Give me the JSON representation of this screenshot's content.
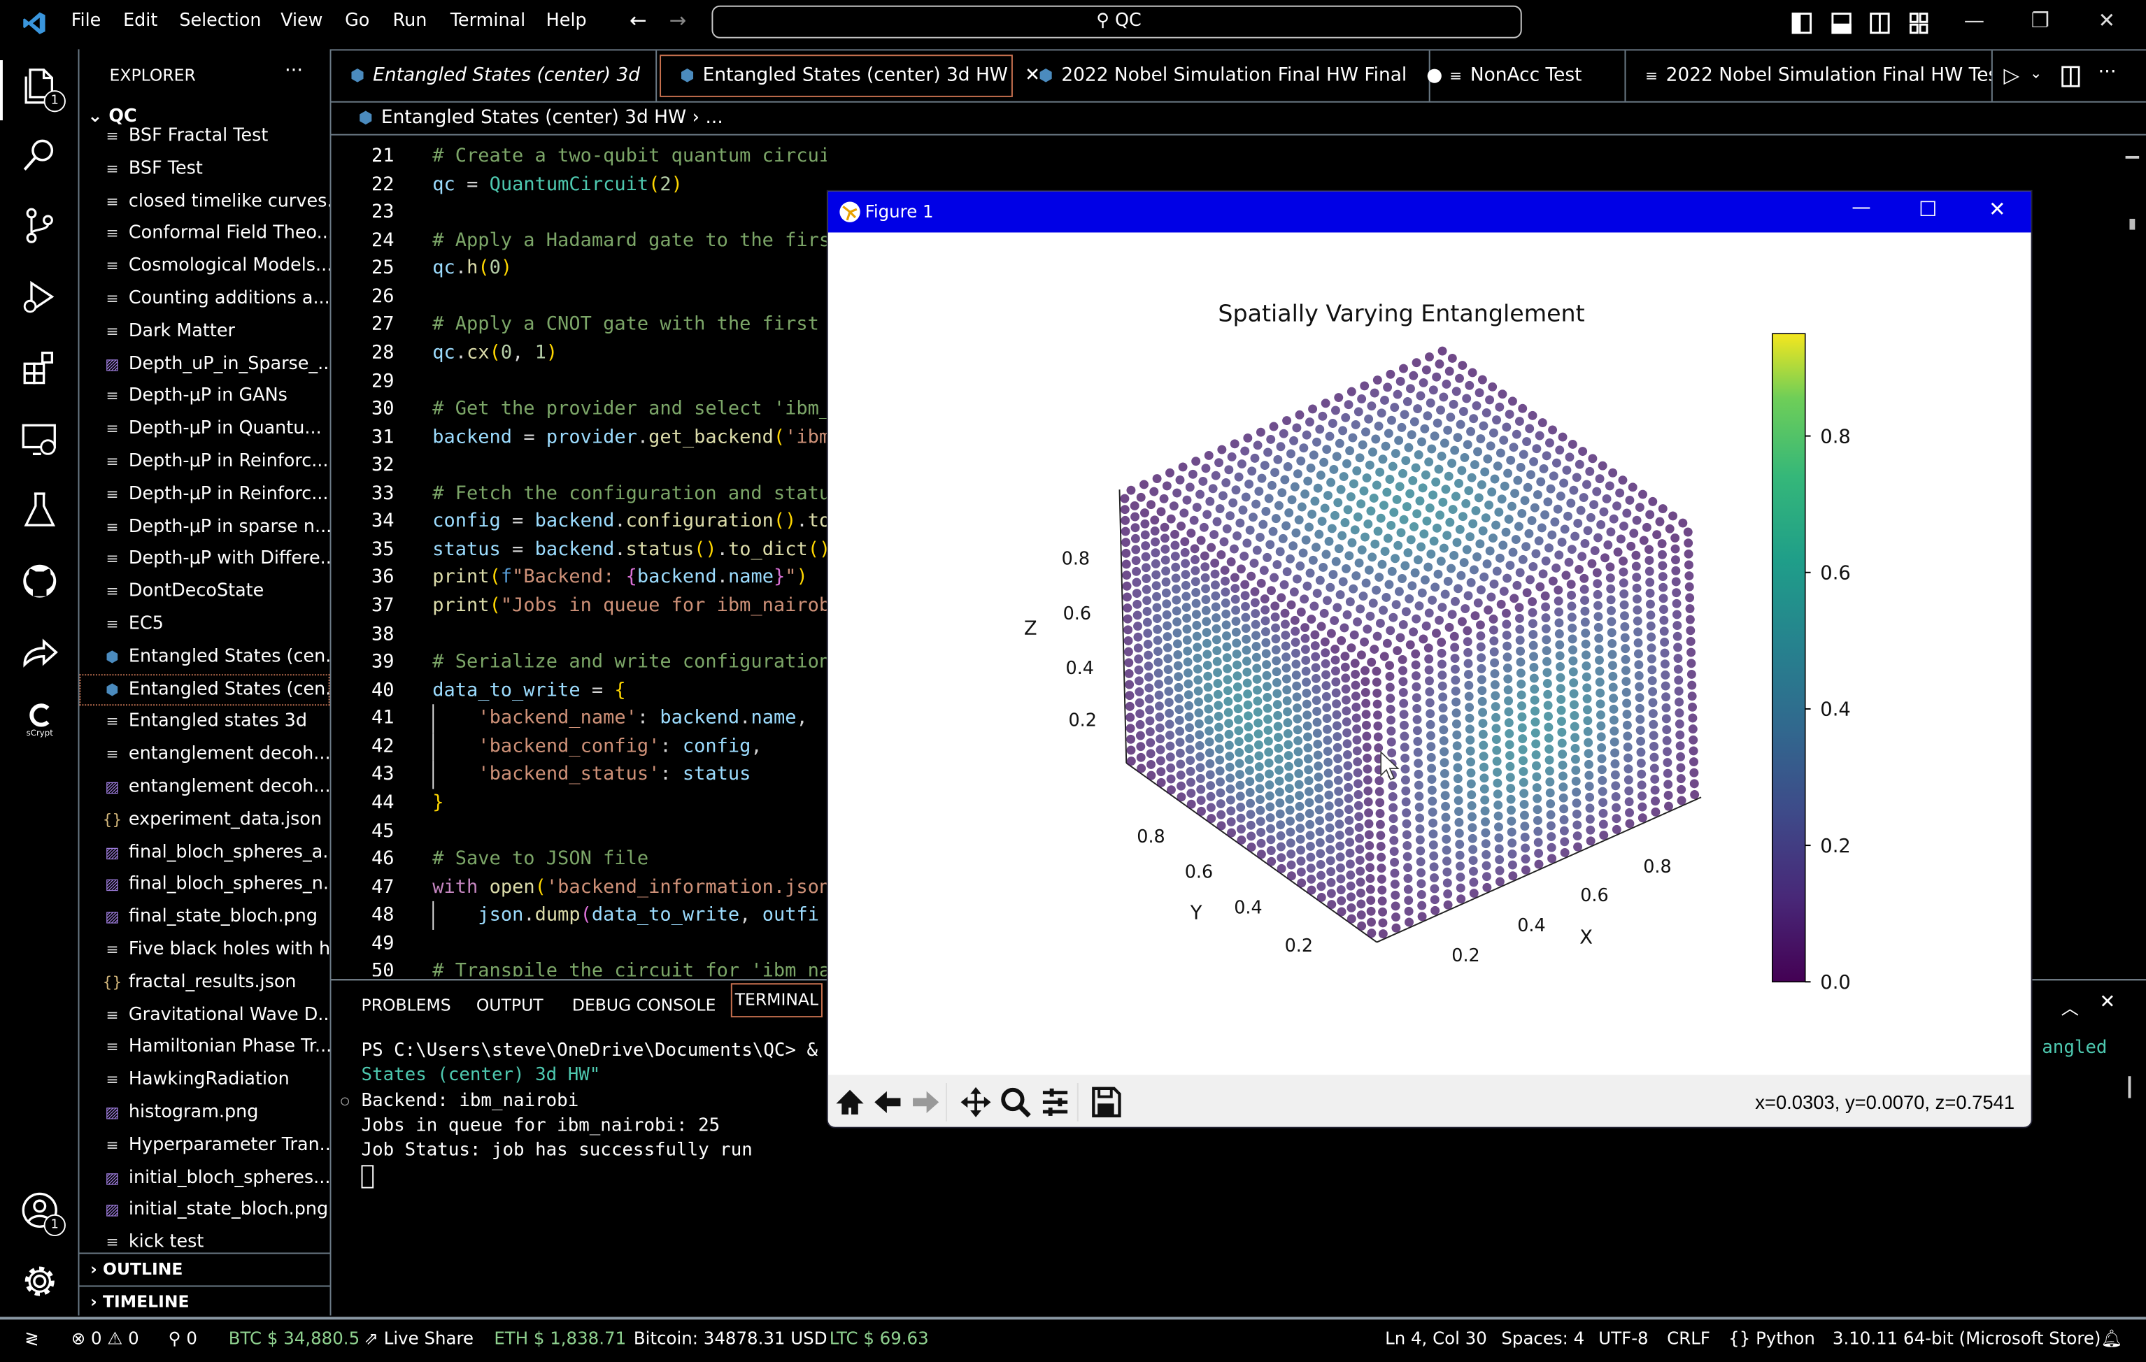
{
  "titlebar": {
    "menu": [
      "File",
      "Edit",
      "Selection",
      "View",
      "Go",
      "Run",
      "Terminal",
      "Help"
    ],
    "search": "QC"
  },
  "activity_bar": {
    "explorer_badge": "1",
    "accounts_badge": "1",
    "scrypt_label": "sCrypt"
  },
  "sidebar": {
    "title": "EXPLORER",
    "more": "···",
    "root": "QC",
    "items": [
      {
        "label": "BSF Fractal Test",
        "icon": "file-lines"
      },
      {
        "label": "BSF Test",
        "icon": "file-lines"
      },
      {
        "label": "closed timelike curves...",
        "icon": "file-lines"
      },
      {
        "label": "Conformal Field Theo...",
        "icon": "file-lines"
      },
      {
        "label": "Cosmological Models...",
        "icon": "file-lines"
      },
      {
        "label": "Counting additions a...",
        "icon": "file-lines"
      },
      {
        "label": "Dark Matter",
        "icon": "file-lines"
      },
      {
        "label": "Depth_uP_in_Sparse_...",
        "icon": "image"
      },
      {
        "label": "Depth-μP in GANs",
        "icon": "file-lines"
      },
      {
        "label": "Depth-μP in Quantu...",
        "icon": "file-lines"
      },
      {
        "label": "Depth-μP in Reinforc...",
        "icon": "file-lines"
      },
      {
        "label": "Depth-μP in Reinforc...",
        "icon": "file-lines"
      },
      {
        "label": "Depth-μP in sparse n...",
        "icon": "file-lines"
      },
      {
        "label": "Depth-μP with Differe...",
        "icon": "file-lines"
      },
      {
        "label": "DontDecoState",
        "icon": "file-lines"
      },
      {
        "label": "EC5",
        "icon": "file-lines"
      },
      {
        "label": "Entangled States (cen...",
        "icon": "python"
      },
      {
        "label": "Entangled States (cen...",
        "icon": "python",
        "selected": true
      },
      {
        "label": "Entangled states 3d",
        "icon": "file-lines"
      },
      {
        "label": "entanglement decoh...",
        "icon": "file-lines"
      },
      {
        "label": "entanglement decoh...",
        "icon": "image"
      },
      {
        "label": "experiment_data.json",
        "icon": "json"
      },
      {
        "label": "final_bloch_spheres_a...",
        "icon": "image"
      },
      {
        "label": "final_bloch_spheres_n...",
        "icon": "image"
      },
      {
        "label": "final_state_bloch.png",
        "icon": "image"
      },
      {
        "label": "Five black holes with hr",
        "icon": "file-lines"
      },
      {
        "label": "fractal_results.json",
        "icon": "json"
      },
      {
        "label": "Gravitational Wave D...",
        "icon": "file-lines"
      },
      {
        "label": "Hamiltonian Phase Tr...",
        "icon": "file-lines"
      },
      {
        "label": "HawkingRadiation",
        "icon": "file-lines"
      },
      {
        "label": "histogram.png",
        "icon": "image"
      },
      {
        "label": "Hyperparameter Tran...",
        "icon": "file-lines"
      },
      {
        "label": "initial_bloch_spheres....",
        "icon": "image"
      },
      {
        "label": "initial_state_bloch.png",
        "icon": "image"
      },
      {
        "label": "kick test",
        "icon": "file-lines"
      }
    ],
    "outline": "OUTLINE",
    "timeline": "TIMELINE"
  },
  "tabs": [
    {
      "label": "Entangled States (center) 3d",
      "icon": "python",
      "italic": true
    },
    {
      "label": "Entangled States (center) 3d HW",
      "icon": "python",
      "active": true,
      "close": "✕"
    },
    {
      "label": "2022 Nobel Simulation Final HW Final",
      "icon": "python",
      "dirty": "●"
    },
    {
      "label": "NonAcc Test",
      "icon": "file-lines"
    },
    {
      "label": "2022 Nobel Simulation Final HW Test",
      "icon": "file-lines"
    }
  ],
  "breadcrumb": {
    "file": "Entangled States (center) 3d HW",
    "sep": "›",
    "rest": "..."
  },
  "code": [
    {
      "n": "21",
      "t": [
        [
          "# Create a two-qubit quantum circuit",
          "c"
        ]
      ]
    },
    {
      "n": "22",
      "t": [
        [
          "qc",
          "v"
        ],
        [
          " = ",
          "o"
        ],
        [
          "QuantumCircuit",
          "cl"
        ],
        [
          "(",
          "b"
        ],
        [
          "2",
          "n"
        ],
        [
          ")",
          "b"
        ]
      ]
    },
    {
      "n": "23",
      "t": []
    },
    {
      "n": "24",
      "t": [
        [
          "# Apply a Hadamard gate to the firs",
          "c"
        ]
      ]
    },
    {
      "n": "25",
      "t": [
        [
          "qc",
          "v"
        ],
        [
          ".",
          "p"
        ],
        [
          "h",
          "f"
        ],
        [
          "(",
          "b"
        ],
        [
          "0",
          "n"
        ],
        [
          ")",
          "b"
        ]
      ]
    },
    {
      "n": "26",
      "t": []
    },
    {
      "n": "27",
      "t": [
        [
          "# Apply a CNOT gate with the first",
          "c"
        ]
      ]
    },
    {
      "n": "28",
      "t": [
        [
          "qc",
          "v"
        ],
        [
          ".",
          "p"
        ],
        [
          "cx",
          "f"
        ],
        [
          "(",
          "b"
        ],
        [
          "0",
          "n"
        ],
        [
          ", ",
          "p"
        ],
        [
          "1",
          "n"
        ],
        [
          ")",
          "b"
        ]
      ]
    },
    {
      "n": "29",
      "t": []
    },
    {
      "n": "30",
      "t": [
        [
          "# Get the provider and select 'ibm_",
          "c"
        ]
      ]
    },
    {
      "n": "31",
      "t": [
        [
          "backend",
          "v"
        ],
        [
          " = ",
          "o"
        ],
        [
          "provider",
          "v"
        ],
        [
          ".",
          "p"
        ],
        [
          "get_backend",
          "f"
        ],
        [
          "(",
          "b"
        ],
        [
          "'ibm",
          "s"
        ]
      ]
    },
    {
      "n": "32",
      "t": []
    },
    {
      "n": "33",
      "t": [
        [
          "# Fetch the configuration and statu",
          "c"
        ]
      ]
    },
    {
      "n": "34",
      "t": [
        [
          "config",
          "v"
        ],
        [
          " = ",
          "o"
        ],
        [
          "backend",
          "v"
        ],
        [
          ".",
          "p"
        ],
        [
          "configuration",
          "f"
        ],
        [
          "()",
          "b"
        ],
        [
          ".",
          "p"
        ],
        [
          "to",
          "f"
        ]
      ]
    },
    {
      "n": "35",
      "t": [
        [
          "status",
          "v"
        ],
        [
          " = ",
          "o"
        ],
        [
          "backend",
          "v"
        ],
        [
          ".",
          "p"
        ],
        [
          "status",
          "f"
        ],
        [
          "()",
          "b"
        ],
        [
          ".",
          "p"
        ],
        [
          "to_dict",
          "f"
        ],
        [
          "()",
          "b"
        ]
      ]
    },
    {
      "n": "36",
      "t": [
        [
          "print",
          "f"
        ],
        [
          "(",
          "b"
        ],
        [
          "f",
          "kb"
        ],
        [
          "\"Backend: ",
          "s"
        ],
        [
          "{",
          "bp"
        ],
        [
          "backend",
          "v"
        ],
        [
          ".",
          "p"
        ],
        [
          "name",
          "v"
        ],
        [
          "}",
          "bp"
        ],
        [
          "\"",
          "s"
        ],
        [
          ")",
          "b"
        ]
      ]
    },
    {
      "n": "37",
      "t": [
        [
          "print",
          "f"
        ],
        [
          "(",
          "b"
        ],
        [
          "\"Jobs in queue for ibm_nairob",
          "s"
        ]
      ]
    },
    {
      "n": "38",
      "t": []
    },
    {
      "n": "39",
      "t": [
        [
          "# Serialize and write configuration",
          "c"
        ]
      ]
    },
    {
      "n": "40",
      "t": [
        [
          "data_to_write",
          "v"
        ],
        [
          " = ",
          "o"
        ],
        [
          "{",
          "b"
        ]
      ]
    },
    {
      "n": "41",
      "t": [
        [
          "    ",
          "p"
        ],
        [
          "'backend_name'",
          "s"
        ],
        [
          ": ",
          "p"
        ],
        [
          "backend",
          "v"
        ],
        [
          ".",
          "p"
        ],
        [
          "name",
          "v"
        ],
        [
          ",",
          "p"
        ]
      ]
    },
    {
      "n": "42",
      "t": [
        [
          "    ",
          "p"
        ],
        [
          "'backend_config'",
          "s"
        ],
        [
          ": ",
          "p"
        ],
        [
          "config",
          "v"
        ],
        [
          ",",
          "p"
        ]
      ]
    },
    {
      "n": "43",
      "t": [
        [
          "    ",
          "p"
        ],
        [
          "'backend_status'",
          "s"
        ],
        [
          ": ",
          "p"
        ],
        [
          "status",
          "v"
        ]
      ]
    },
    {
      "n": "44",
      "t": [
        [
          "}",
          "b"
        ]
      ]
    },
    {
      "n": "45",
      "t": []
    },
    {
      "n": "46",
      "t": [
        [
          "# Save to JSON file",
          "c"
        ]
      ]
    },
    {
      "n": "47",
      "t": [
        [
          "with",
          "k"
        ],
        [
          " ",
          "p"
        ],
        [
          "open",
          "f"
        ],
        [
          "(",
          "b"
        ],
        [
          "'backend_information.json",
          "s"
        ]
      ]
    },
    {
      "n": "48",
      "t": [
        [
          "    ",
          "p"
        ],
        [
          "json",
          "v"
        ],
        [
          ".",
          "p"
        ],
        [
          "dump",
          "f"
        ],
        [
          "(",
          "bp"
        ],
        [
          "data_to_write",
          "v"
        ],
        [
          ", ",
          "p"
        ],
        [
          "outfi",
          "v"
        ]
      ]
    },
    {
      "n": "49",
      "t": []
    },
    {
      "n": "50",
      "t": [
        [
          "# Transpile the circuit for 'ibm_na",
          "c"
        ]
      ]
    }
  ],
  "panel": {
    "tabs": [
      "PROBLEMS",
      "OUTPUT",
      "DEBUG CONSOLE",
      "TERMINAL"
    ],
    "terminal": [
      {
        "text": "PS C:\\Users\\steve\\OneDrive\\Documents\\QC> &",
        "color": "#ffffff"
      },
      {
        "text": "States (center) 3d HW\"",
        "color": "#4ec9b0"
      },
      {
        "text": "Backend: ibm_nairobi",
        "color": "#ffffff",
        "marker": "○"
      },
      {
        "text": "Jobs in queue for ibm_nairobi: 25",
        "color": "#ffffff"
      },
      {
        "text": "Job Status: job has successfully run",
        "color": "#ffffff"
      }
    ],
    "terminal_fragment": "angled"
  },
  "statusbar": {
    "errors": "0",
    "warnings": "0",
    "ports": "0",
    "btc": "BTC $ 34,880.5",
    "liveshare": "Live Share",
    "eth": "ETH $ 1,838.71",
    "bitcoin": "Bitcoin: 34878.31 USD",
    "ltc": "LTC $ 69.63",
    "position": "Ln 4, Col 30",
    "spaces": "Spaces: 4",
    "encoding": "UTF-8",
    "eol": "CRLF",
    "language": "Python",
    "interpreter": "3.10.11 64-bit (Microsoft Store)"
  },
  "figure": {
    "window_title": "Figure 1",
    "titlebar_color": "#0000e6",
    "coords_readout": "x=0.0303, y=0.0070, z=0.7541"
  },
  "chart_data": {
    "type": "scatter3d",
    "title": "Spatially Varying Entanglement",
    "xlabel": "X",
    "ylabel": "Y",
    "zlabel": "Z",
    "xlim": [
      0,
      1
    ],
    "ylim": [
      0,
      1
    ],
    "zlim": [
      0,
      1
    ],
    "xticks": [
      "0.2",
      "0.4",
      "0.6",
      "0.8"
    ],
    "yticks": [
      "0.2",
      "0.4",
      "0.6",
      "0.8"
    ],
    "zticks": [
      "0.2",
      "0.4",
      "0.6",
      "0.8"
    ],
    "grid_points_per_axis": 25,
    "colormap": "viridis",
    "colorbar": {
      "range": [
        0,
        0.95
      ],
      "ticks": [
        "0.0",
        "0.2",
        "0.4",
        "0.6",
        "0.8"
      ]
    },
    "value_pattern": "low (purple) at cube corners and center, higher (teal ~0.45) in a spherical shell"
  }
}
